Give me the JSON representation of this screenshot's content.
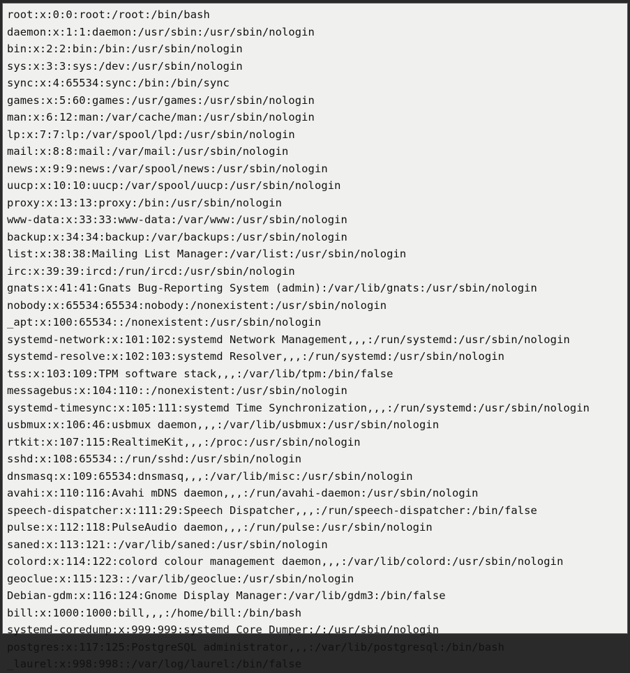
{
  "file": {
    "lines": [
      "root:x:0:0:root:/root:/bin/bash",
      "daemon:x:1:1:daemon:/usr/sbin:/usr/sbin/nologin",
      "bin:x:2:2:bin:/bin:/usr/sbin/nologin",
      "sys:x:3:3:sys:/dev:/usr/sbin/nologin",
      "sync:x:4:65534:sync:/bin:/bin/sync",
      "games:x:5:60:games:/usr/games:/usr/sbin/nologin",
      "man:x:6:12:man:/var/cache/man:/usr/sbin/nologin",
      "lp:x:7:7:lp:/var/spool/lpd:/usr/sbin/nologin",
      "mail:x:8:8:mail:/var/mail:/usr/sbin/nologin",
      "news:x:9:9:news:/var/spool/news:/usr/sbin/nologin",
      "uucp:x:10:10:uucp:/var/spool/uucp:/usr/sbin/nologin",
      "proxy:x:13:13:proxy:/bin:/usr/sbin/nologin",
      "www-data:x:33:33:www-data:/var/www:/usr/sbin/nologin",
      "backup:x:34:34:backup:/var/backups:/usr/sbin/nologin",
      "list:x:38:38:Mailing List Manager:/var/list:/usr/sbin/nologin",
      "irc:x:39:39:ircd:/run/ircd:/usr/sbin/nologin",
      "gnats:x:41:41:Gnats Bug-Reporting System (admin):/var/lib/gnats:/usr/sbin/nologin",
      "nobody:x:65534:65534:nobody:/nonexistent:/usr/sbin/nologin",
      "_apt:x:100:65534::/nonexistent:/usr/sbin/nologin",
      "systemd-network:x:101:102:systemd Network Management,,,:/run/systemd:/usr/sbin/nologin",
      "systemd-resolve:x:102:103:systemd Resolver,,,:/run/systemd:/usr/sbin/nologin",
      "tss:x:103:109:TPM software stack,,,:/var/lib/tpm:/bin/false",
      "messagebus:x:104:110::/nonexistent:/usr/sbin/nologin",
      "systemd-timesync:x:105:111:systemd Time Synchronization,,,:/run/systemd:/usr/sbin/nologin",
      "usbmux:x:106:46:usbmux daemon,,,:/var/lib/usbmux:/usr/sbin/nologin",
      "rtkit:x:107:115:RealtimeKit,,,:/proc:/usr/sbin/nologin",
      "sshd:x:108:65534::/run/sshd:/usr/sbin/nologin",
      "dnsmasq:x:109:65534:dnsmasq,,,:/var/lib/misc:/usr/sbin/nologin",
      "avahi:x:110:116:Avahi mDNS daemon,,,:/run/avahi-daemon:/usr/sbin/nologin",
      "speech-dispatcher:x:111:29:Speech Dispatcher,,,:/run/speech-dispatcher:/bin/false",
      "pulse:x:112:118:PulseAudio daemon,,,:/run/pulse:/usr/sbin/nologin",
      "saned:x:113:121::/var/lib/saned:/usr/sbin/nologin",
      "colord:x:114:122:colord colour management daemon,,,:/var/lib/colord:/usr/sbin/nologin",
      "geoclue:x:115:123::/var/lib/geoclue:/usr/sbin/nologin",
      "Debian-gdm:x:116:124:Gnome Display Manager:/var/lib/gdm3:/bin/false",
      "bill:x:1000:1000:bill,,,:/home/bill:/bin/bash",
      "systemd-coredump:x:999:999:systemd Core Dumper:/:/usr/sbin/nologin",
      "postgres:x:117:125:PostgreSQL administrator,,,:/var/lib/postgresql:/bin/bash",
      "_laurel:x:998:998::/var/log/laurel:/bin/false"
    ]
  }
}
